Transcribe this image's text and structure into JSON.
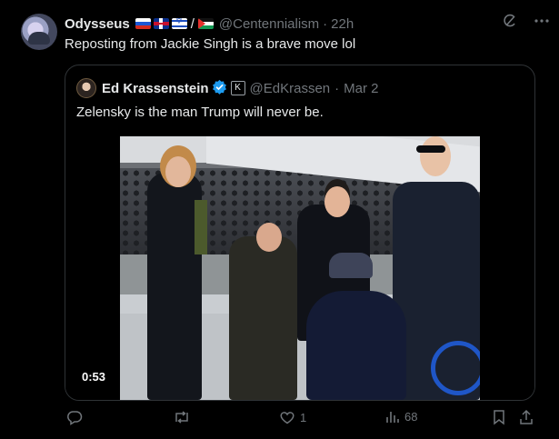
{
  "post": {
    "author_name": "Odysseus",
    "flag_icons": [
      "flag-russia",
      "flag-uk",
      "flag-israel",
      "flag-palestine"
    ],
    "flag_separator": "/",
    "handle": "@Centennialism",
    "separator": "·",
    "time": "22h",
    "text": "Reposting from Jackie Singh is a brave move lol"
  },
  "quote": {
    "author_name": "Ed Krassenstein",
    "verified_icon": "verified-badge-icon",
    "affiliate_badge": "K",
    "handle": "@EdKrassen",
    "separator": "·",
    "date": "Mar 2",
    "text": "Zelensky is the man Trump will never be.",
    "video_duration": "0:53"
  },
  "actions": {
    "reply_count": "",
    "repost_count": "",
    "like_count": "1",
    "views_count": "68"
  },
  "colors": {
    "background": "#000000",
    "text_primary": "#e7e9ea",
    "text_secondary": "#71767b",
    "border": "#2f3336",
    "verified_blue": "#1d9bf0"
  }
}
